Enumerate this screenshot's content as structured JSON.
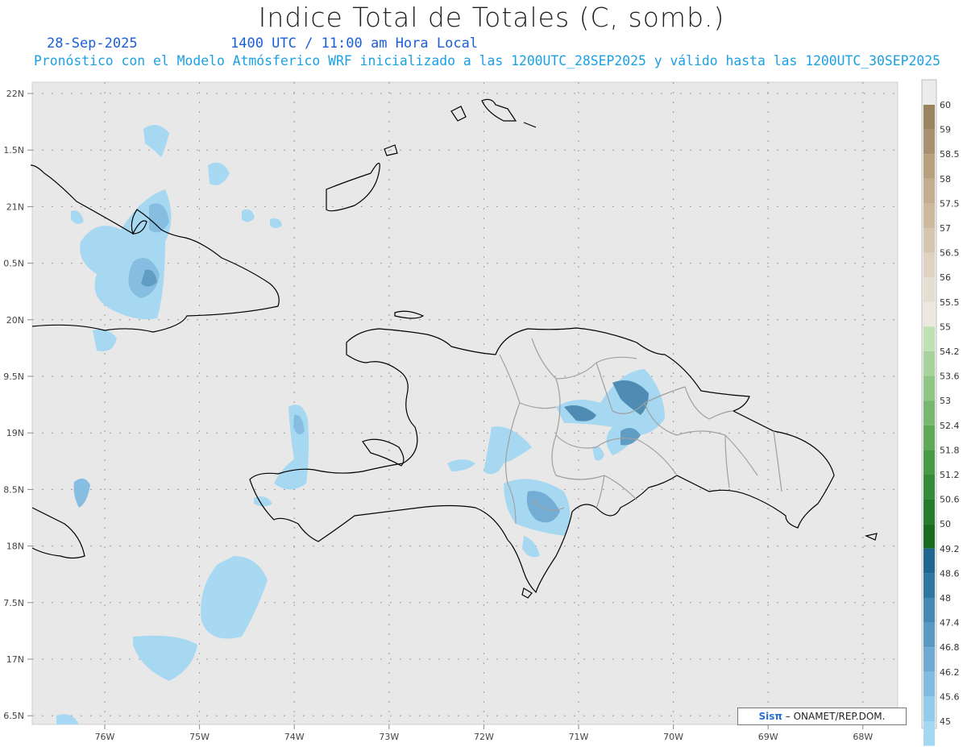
{
  "title": "Indice Total de Totales (C, somb.)",
  "date": "28-Sep-2025",
  "time": "1400 UTC / 11:00 am Hora Local",
  "subtitle": "Pronóstico con el Modelo Atmósferico WRF inicializado a las 1200UTC_28SEP2025 y válido hasta las  1200UTC_30SEP2025",
  "credit": {
    "brand": "Sisπ",
    "text": "– ONAMET/REP.DOM."
  },
  "map": {
    "lon_range": [
      -76.6,
      -67.6
    ],
    "lat_range": [
      16.4,
      22.1
    ],
    "lat_labels": [
      "22N",
      "1.5N",
      "21N",
      "0.5N",
      "20N",
      "9.5N",
      "19N",
      "8.5N",
      "18N",
      "7.5N",
      "17N",
      "6.5N"
    ],
    "lon_labels": [
      "76W",
      "75W",
      "74W",
      "73W",
      "72W",
      "71W",
      "70W",
      "69W",
      "68W"
    ],
    "background_color": "#e8e8e8",
    "coast_color": "#000000",
    "province_color": "#a0a0a0"
  },
  "colorbar": {
    "labels": [
      "60",
      "59",
      "58.5",
      "58",
      "57.5",
      "57",
      "56.5",
      "56",
      "55.5",
      "55",
      "54.2",
      "53.6",
      "53",
      "52.4",
      "51.8",
      "51.2",
      "50.6",
      "50",
      "49.2",
      "48.6",
      "48",
      "47.4",
      "46.8",
      "46.2",
      "45.6",
      "45"
    ],
    "colors": [
      "#9a8460",
      "#a89070",
      "#b8a07e",
      "#c3ad8e",
      "#ccb99e",
      "#d6c6af",
      "#ded2c1",
      "#e6ded2",
      "#ede8de",
      "#bfe1b4",
      "#a8d29c",
      "#8fc585",
      "#78b76f",
      "#5fa85a",
      "#499a48",
      "#358b39",
      "#267b2c",
      "#1b6a22",
      "#1f6690",
      "#2f77a0",
      "#4688b2",
      "#5a99c2",
      "#6eaad2",
      "#81bbe0",
      "#93cbeb",
      "#a4d8f2"
    ]
  },
  "shading_note": ""
}
